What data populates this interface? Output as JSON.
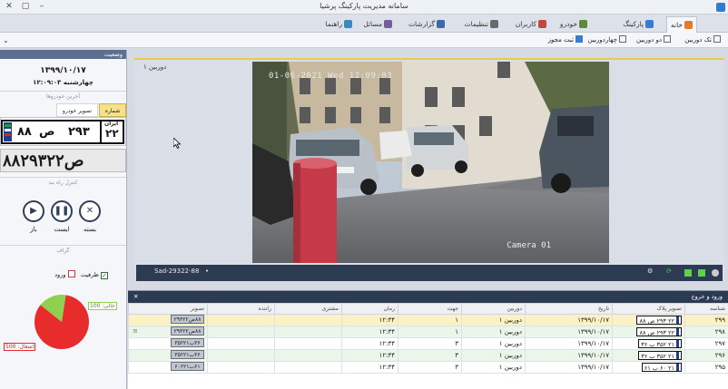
{
  "window": {
    "title": "سامانه مدیریت پارکینگ پرشیا"
  },
  "tabs": [
    {
      "label": "خانه",
      "color": "#e07b2a"
    },
    {
      "label": "پارکینگ",
      "color": "#3a7bd5"
    },
    {
      "label": "خودرو",
      "color": "#5a8a3a"
    },
    {
      "label": "کاربران",
      "color": "#c04a3a"
    },
    {
      "label": "تنظیمات",
      "color": "#6a6a6a"
    },
    {
      "label": "گزارشات",
      "color": "#3a6aa8"
    },
    {
      "label": "مسائل",
      "color": "#7a5aa0"
    },
    {
      "label": "راهنما",
      "color": "#3a8ac0"
    }
  ],
  "toolbar": [
    {
      "label": "تک دوربین"
    },
    {
      "label": "دو دوربین"
    },
    {
      "label": "چهاردوربین"
    },
    {
      "label": "ثبت مجوز"
    }
  ],
  "status_panel": {
    "header": "وضعیت",
    "date": "۱۳۹۹/۱۰/۱۷",
    "day_time": "چهارشنبه ۱۲:۰۹:۰۳",
    "recent_vehicles_label": "آخرین خودروها",
    "tab_plate": "شماره پلاک",
    "tab_vehicle_image": "تصویر خودرو",
    "plate": {
      "p1": "۸۸",
      "letter": "ص",
      "p2": "۲۹۳",
      "region_label": "ایران",
      "region": "۲۲"
    },
    "plate_crop_text": "۸۸ص۲۹۳۲۲",
    "gate_control_label": "کنترل راه بند",
    "gate_buttons": [
      {
        "label": "بسته",
        "icon": "close-icon"
      },
      {
        "label": "ایست",
        "icon": "pause-icon"
      },
      {
        "label": "باز",
        "icon": "play-icon"
      }
    ],
    "chart_section_label": "گراف",
    "legend_capacity": "ظرفیت",
    "legend_entry": "ورود"
  },
  "chart_data": {
    "type": "pie",
    "slices": [
      {
        "label": "اشغال",
        "value": 500,
        "color": "#e82c2c"
      },
      {
        "label": "خالی",
        "value": 100,
        "color": "#8fd14f"
      }
    ]
  },
  "camera": {
    "title": "دوربین ۱",
    "osd_timestamp": "01-06-2021 Wed 12:09:03",
    "osd_label": "Camera 01",
    "plate_readout": "Sad-29322-88"
  },
  "entry_exit": {
    "header": "ورود و خروج",
    "columns": [
      "شناسه",
      "تصویر پلاک",
      "تاریخ",
      "دوربین",
      "جهت",
      "زمان",
      "مشتری",
      "راننده",
      "تصویر"
    ],
    "rows": [
      {
        "id": "۲۹۹",
        "plate": "۲۲ ۲۹۳ ص ۸۸",
        "date": "۱۳۹۹/۱۰/۱۷",
        "camera": "دوربین ۱",
        "dir": "۱",
        "time": "۱۲:۳۴",
        "customer": "",
        "driver": "",
        "img": "۸۸ص۲۹۳۲۲"
      },
      {
        "id": "۲۹۸",
        "plate": "۲۲ ۲۹۳ ص ۸۸",
        "date": "۱۳۹۹/۱۰/۱۷",
        "camera": "دوربین ۱",
        "dir": "۱",
        "time": "۱۲:۳۴",
        "customer": "",
        "driver": "",
        "img": "۸۸ص۲۹۳۲۲"
      },
      {
        "id": "۲۹۷",
        "plate": "۲۱ ۳۵۲ ب ۳۶",
        "date": "۱۳۹۹/۱۰/۱۷",
        "camera": "دوربین ۱",
        "dir": "۳",
        "time": "۱۲:۳۴",
        "customer": "",
        "driver": "",
        "img": "۳۶ب۳۵۲۲۱"
      },
      {
        "id": "۲۹۶",
        "plate": "۲۱ ۳۵۲ ب ۳۶",
        "date": "۱۳۹۹/۱۰/۱۷",
        "camera": "دوربین ۱",
        "dir": "۳",
        "time": "۱۲:۳۴",
        "customer": "",
        "driver": "",
        "img": "۳۶ب۳۵۲۲۱"
      },
      {
        "id": "۲۹۵",
        "plate": "۲۱ ۶۰ ب ۶۱",
        "date": "۱۳۹۹/۱۰/۱۷",
        "camera": "دوربین ۱",
        "dir": "۳",
        "time": "۱۲:۳۴",
        "customer": "",
        "driver": "",
        "img": "۶۱ب۶۰۲۲۱"
      }
    ]
  }
}
